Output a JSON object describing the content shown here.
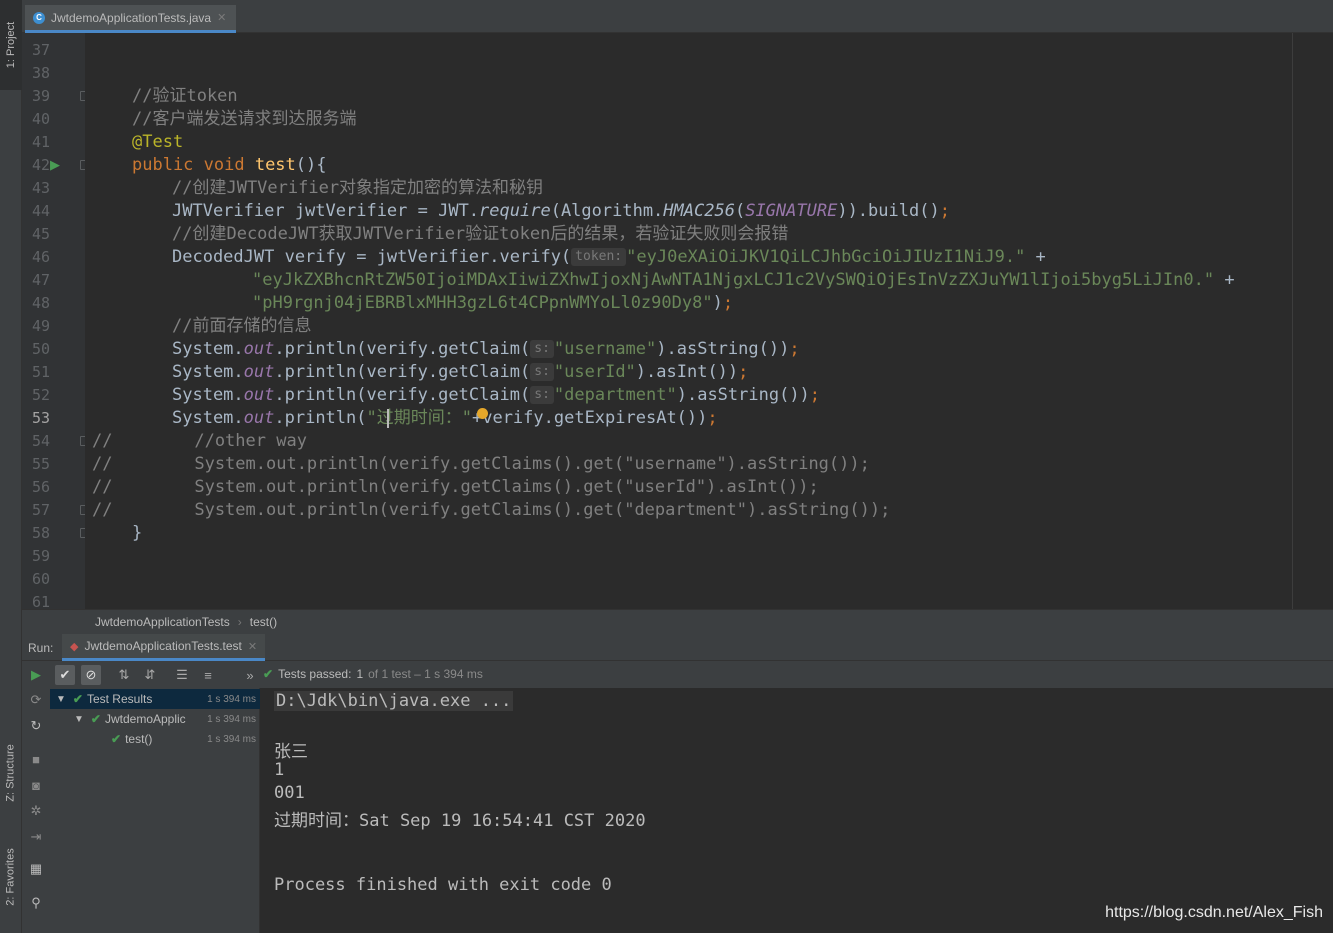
{
  "sidebar": {
    "project_tab": "1: Project",
    "structure_tab": "Z: Structure",
    "favorites_tab": "2: Favorites"
  },
  "editor": {
    "tab_label": "JwtdemoApplicationTests.java",
    "line_numbers": [
      "37",
      "38",
      "39",
      "40",
      "41",
      "42",
      "43",
      "44",
      "45",
      "46",
      "47",
      "48",
      "49",
      "50",
      "51",
      "52",
      "53",
      "54",
      "55",
      "56",
      "57",
      "58",
      "59",
      "60",
      "61"
    ],
    "current_line": "53",
    "code": {
      "l39": "//验证token",
      "l40": "//客户端发送请求到达服务端",
      "l41": "@Test",
      "l42_kw": "public void ",
      "l42_fn": "test",
      "l42_end": "(){",
      "l43": "//创建JWTVerifier对象指定加密的算法和秘钥",
      "l44_a": "JWTVerifier jwtVerifier = JWT.",
      "l44_b": "require",
      "l44_c": "(Algorithm.",
      "l44_d": "HMAC256",
      "l44_e": "(",
      "l44_f": "SIGNATURE",
      "l44_g": ")).build()",
      "l44_h": ";",
      "l45": "//创建DecodeJWT获取JWTVerifier验证token后的结果，若验证失败则会报错",
      "l46_a": "DecodedJWT verify = jwtVerifier.verify(",
      "l46_hint": "token:",
      "l46_str": "\"eyJ0eXAiOiJKV1QiLCJhbGciOiJIUzI1NiJ9.\"",
      "l46_end": " +",
      "l47_str": "\"eyJkZXBhcnRtZW50IjoiMDAxIiwiZXhwIjoxNjAwNTA1NjgxLCJ1c2VySWQiOjEsInVzZXJuYW1lIjoi5byg5LiJIn0.\"",
      "l47_end": " +",
      "l48_str": "\"pH9rgnj04jEBRBlxMHH3gzL6t4CPpnWMYoLl0z90Dy8\"",
      "l48_end": ")",
      "l48_semi": ";",
      "l49": "//前面存储的信息",
      "sys": "System.",
      "out": "out",
      "println": ".println(verify.getClaim(",
      "hint_s": "s:",
      "l50_str": "\"username\"",
      "l50_end": ").asString())",
      "l51_str": "\"userId\"",
      "l51_end": ").asInt())",
      "l52_str": "\"department\"",
      "l52_end": ").asString())",
      "semi": ";",
      "l53_a": ".println(",
      "l53_str": "\"过期时间：\"",
      "l53_b": "+verify.getExpiresAt())",
      "l54": "//        //other way",
      "l55": "//        System.out.println(verify.getClaims().get(\"username\").asString());",
      "l56": "//        System.out.println(verify.getClaims().get(\"userId\").asInt());",
      "l57": "//        System.out.println(verify.getClaims().get(\"department\").asString());",
      "l58": "}"
    }
  },
  "breadcrumb": {
    "class": "JwtdemoApplicationTests",
    "method": "test()"
  },
  "run": {
    "label": "Run:",
    "config": "JwtdemoApplicationTests.test",
    "status_prefix": "Tests passed:",
    "status_count": "1",
    "status_rest": "of 1 test – 1 s 394 ms",
    "tree": [
      {
        "label": "Test Results",
        "time": "1 s 394 ms"
      },
      {
        "label": "JwtdemoApplic",
        "time": "1 s 394 ms"
      },
      {
        "label": "test()",
        "time": "1 s 394 ms"
      }
    ],
    "console": {
      "cmd": "D:\\Jdk\\bin\\java.exe ...",
      "out1": "张三",
      "out2": "1",
      "out3": "001",
      "out4": "过期时间：Sat Sep 19 16:54:41 CST 2020",
      "exit": "Process finished with exit code 0"
    }
  },
  "watermark": "https://blog.csdn.net/Alex_Fish"
}
